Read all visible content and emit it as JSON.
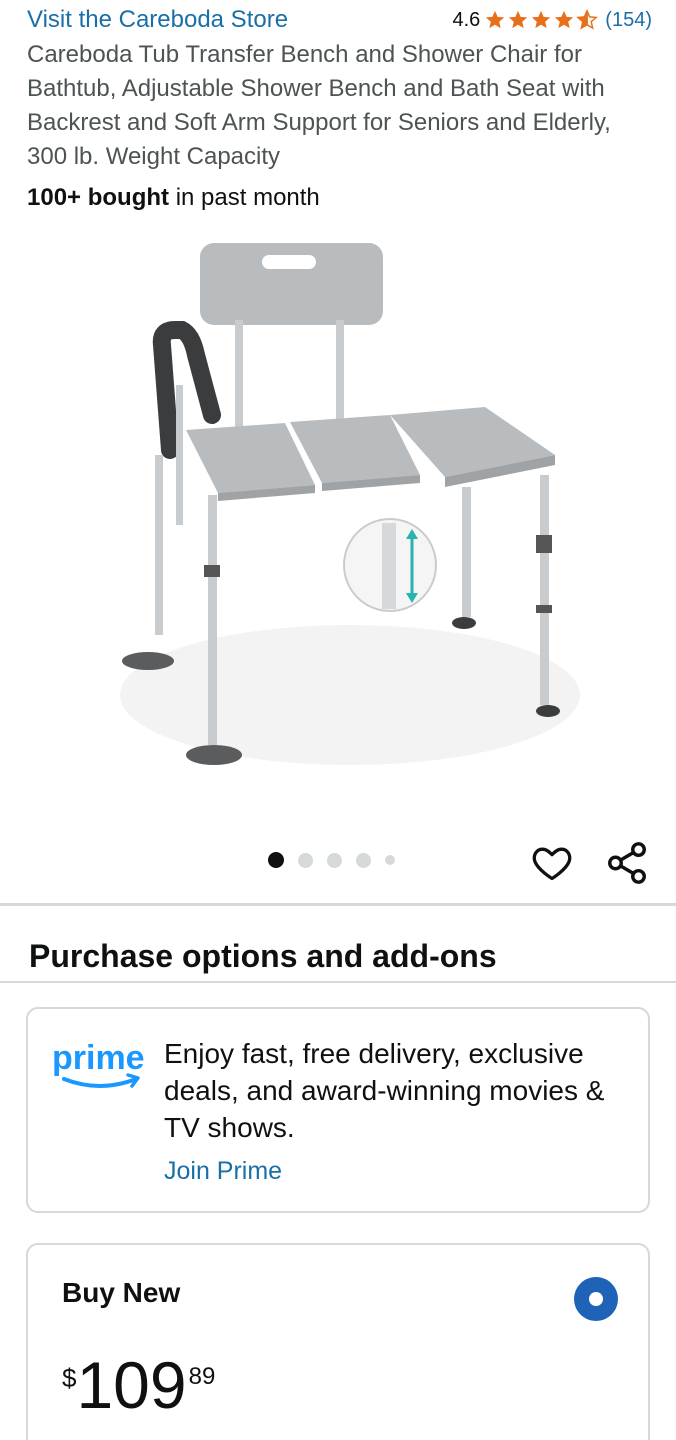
{
  "header": {
    "store_link": "Visit the Careboda Store",
    "rating_value": "4.6",
    "rating_stars": 4.6,
    "review_count": "(154)"
  },
  "product": {
    "title": "Careboda Tub Transfer Bench and Shower Chair for Bathtub, Adjustable Shower Bench and Bath Seat with Backrest and Soft Arm Support for Seniors and Elderly, 300 lb. Weight Capacity",
    "bought_bold": "100+ bought",
    "bought_rest": " in past month",
    "image_icon": "shower-bench-product-photo",
    "image_count": 5,
    "active_image": 1
  },
  "actions": {
    "wishlist_icon": "heart-icon",
    "share_icon": "share-icon"
  },
  "purchase": {
    "section_title": "Purchase options and add-ons"
  },
  "prime": {
    "logo_text": "prime",
    "description": "Enjoy fast, free delivery, exclusive deals, and award-winning movies & TV shows.",
    "join_label": "Join Prime"
  },
  "buy_new": {
    "label": "Buy New",
    "currency_symbol": "$",
    "price_whole": "109",
    "price_fraction": "89",
    "selected": true
  },
  "colors": {
    "link": "#1a6fa8",
    "star": "#e7711b",
    "prime_blue": "#1a98ff",
    "radio_blue": "#1e63b8",
    "divider": "#d5d9d9"
  }
}
